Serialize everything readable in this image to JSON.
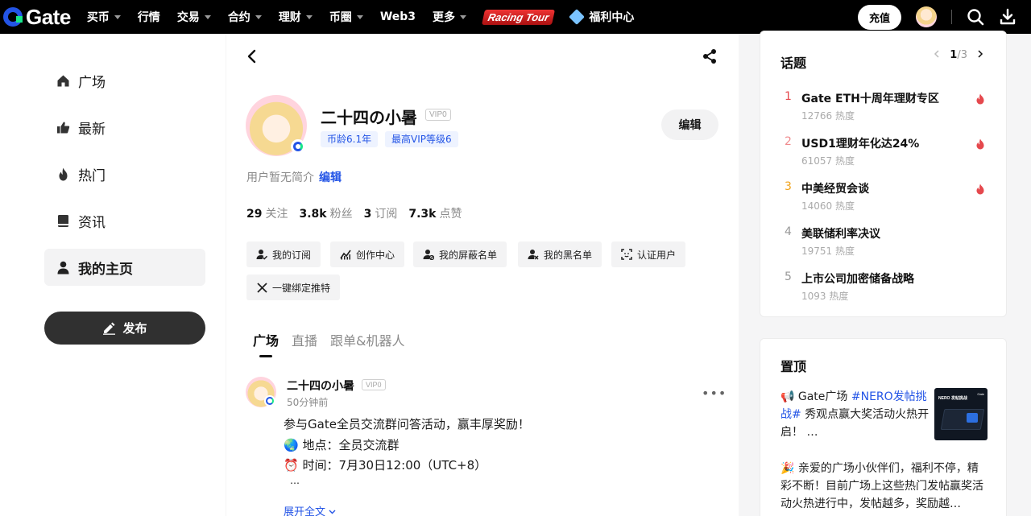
{
  "brand": {
    "name": "Gate"
  },
  "nav": {
    "items": [
      {
        "label": "买币",
        "caret": true
      },
      {
        "label": "行情",
        "caret": false
      },
      {
        "label": "交易",
        "caret": true
      },
      {
        "label": "合约",
        "caret": true
      },
      {
        "label": "理财",
        "caret": true
      },
      {
        "label": "币圈",
        "caret": true
      },
      {
        "label": "Web3",
        "caret": false
      },
      {
        "label": "更多",
        "caret": true
      }
    ],
    "racing_label": "Racing Tour",
    "welfare_label": "福利中心",
    "deposit_label": "充值"
  },
  "sidebar": {
    "items": [
      {
        "label": "广场",
        "icon": "home-icon",
        "active": false
      },
      {
        "label": "最新",
        "icon": "thumbs-up-icon",
        "active": false
      },
      {
        "label": "热门",
        "icon": "flame-icon",
        "active": false
      },
      {
        "label": "资讯",
        "icon": "book-icon",
        "active": false
      },
      {
        "label": "我的主页",
        "icon": "user-icon",
        "active": true
      }
    ],
    "publish_label": "发布"
  },
  "profile": {
    "name": "二十四の小暑",
    "vip": "VIP0",
    "tags": [
      "币龄6.1年",
      "最高VIP等级6"
    ],
    "edit_label": "编辑",
    "bio": "用户暂无简介",
    "bio_edit": "编辑",
    "stats": [
      {
        "value": "29",
        "label": "关注"
      },
      {
        "value": "3.8k",
        "label": "粉丝"
      },
      {
        "value": "3",
        "label": "订阅"
      },
      {
        "value": "7.3k",
        "label": "点赞"
      }
    ],
    "actions": [
      "我的订阅",
      "创作中心",
      "我的屏蔽名单",
      "我的黑名单",
      "认证用户",
      "一键绑定推特"
    ]
  },
  "tabs": [
    "广场",
    "直播",
    "跟单&机器人"
  ],
  "post": {
    "author": "二十四の小暑",
    "vip": "VIP0",
    "time": "50分钟前",
    "more": "•••",
    "lines": [
      "参与Gate全员交流群问答活动，赢丰厚奖励！",
      "🌏 地点：全员交流群",
      "⏰ 时间：7月30日12:00（UTC+8）",
      "…"
    ],
    "expand_label": "展开全文"
  },
  "topics": {
    "title": "话题",
    "page": "1",
    "total": "/3",
    "items": [
      {
        "rank": "1",
        "title": "Gate ETH十周年理财专区",
        "heat": "12766 热度",
        "hot": true,
        "color": "#e5484d"
      },
      {
        "rank": "2",
        "title": "USD1理财年化达24%",
        "heat": "61057 热度",
        "hot": true,
        "color": "#f08a8d"
      },
      {
        "rank": "3",
        "title": "中美经贸会谈",
        "heat": "14060 热度",
        "hot": true,
        "color": "#f0a21b"
      },
      {
        "rank": "4",
        "title": "美联储利率决议",
        "heat": "19751 热度",
        "hot": false,
        "color": "#999999"
      },
      {
        "rank": "5",
        "title": "上市公司加密储备战略",
        "heat": "1093 热度",
        "hot": false,
        "color": "#999999"
      }
    ]
  },
  "pinned": {
    "title": "置顶",
    "item1_prefix": "📢 Gate广场 ",
    "item1_hash": "#NERO发帖挑战#",
    "item1_suffix": " 秀观点赢大奖活动火热开启！ …",
    "thumb_title": "NERO 发帖挑战",
    "thumb_brand": "Gate",
    "item2": "🎉 亲爱的广场小伙伴们，福利不停，精彩不断！目前广场上这些热门发帖赢奖活动火热进行中，发帖越多，奖励越…"
  },
  "colors": {
    "accent": "#2354e6",
    "brand_green": "#17e68a",
    "hot": "#e5484d"
  }
}
